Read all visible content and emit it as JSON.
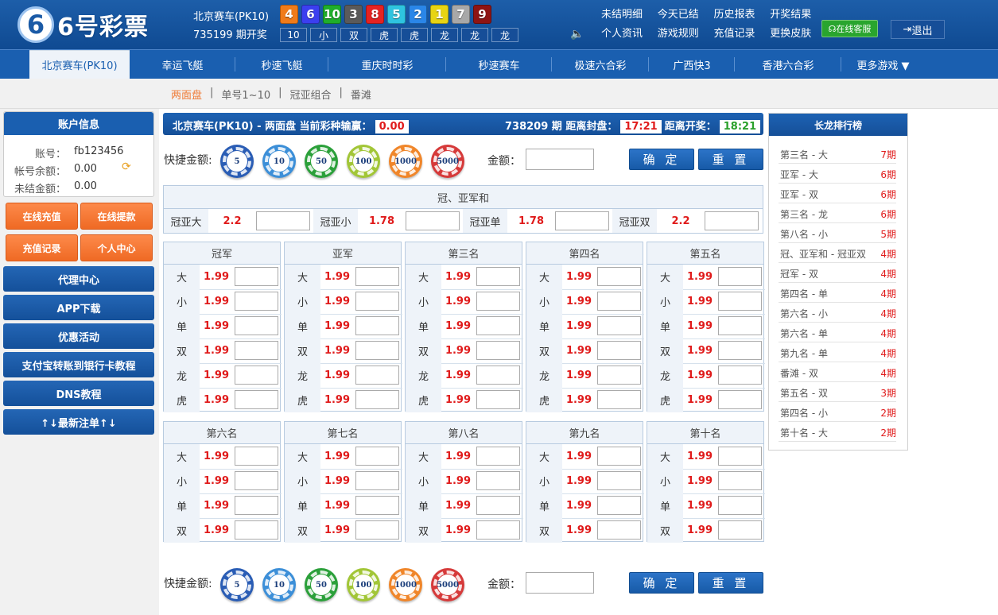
{
  "brand": {
    "logo_mark": "6",
    "logo_text": "6号彩票"
  },
  "header": {
    "lottery_name": "北京赛车(PK10)",
    "last_issue": "735199 期开奖",
    "balls": [
      {
        "num": "4",
        "color": "#f07b1a"
      },
      {
        "num": "6",
        "color": "#3b3ff0"
      },
      {
        "num": "10",
        "color": "#1fae2b"
      },
      {
        "num": "3",
        "color": "#5a5a5a"
      },
      {
        "num": "8",
        "color": "#e52222"
      },
      {
        "num": "5",
        "color": "#2ec4e0"
      },
      {
        "num": "2",
        "color": "#2a86e8"
      },
      {
        "num": "1",
        "color": "#e8d413"
      },
      {
        "num": "7",
        "color": "#a8a8a8"
      },
      {
        "num": "9",
        "color": "#8e1414"
      }
    ],
    "sums": [
      "10",
      "小",
      "双",
      "虎",
      "虎",
      "龙",
      "龙",
      "龙"
    ],
    "links": [
      "未结明细",
      "今天已结",
      "历史报表",
      "开奖结果",
      "个人资讯",
      "游戏规则",
      "充值记录",
      "更换皮肤"
    ],
    "kefu": "在线客服",
    "logout": "退出"
  },
  "nav": {
    "items": [
      "北京赛车(PK10)",
      "幸运飞艇",
      "秒速飞艇",
      "重庆时时彩",
      "秒速赛车",
      "极速六合彩",
      "广西快3",
      "香港六合彩",
      "更多游戏 ▼"
    ]
  },
  "subnav": {
    "items": [
      "两面盘",
      "|",
      "单号1~10",
      "|",
      "冠亚组合",
      "|",
      "番滩"
    ]
  },
  "account": {
    "title": "账户信息",
    "rows": [
      {
        "k": "账号：",
        "v": "fb123456"
      },
      {
        "k": "帐号余额：",
        "v": "0.00"
      },
      {
        "k": "未结金额：",
        "v": "0.00"
      }
    ],
    "buttons": [
      "在线充值",
      "在线提款",
      "充值记录",
      "个人中心"
    ],
    "menu": [
      "代理中心",
      "APP下载",
      "优惠活动",
      "支付宝转账到银行卡教程",
      "DNS教程",
      "↑↓最新注单↑↓"
    ]
  },
  "main": {
    "title": "北京赛车(PK10)  -  两面盘    当前彩种输赢：",
    "winloss": "0.00",
    "issue_text": "738209 期  距离封盘：",
    "close_time": "17:21",
    "open_label": "距离开奖：",
    "open_time": "18:21",
    "quick_label": "快捷金额:",
    "chips": [
      "5",
      "10",
      "50",
      "100",
      "1000",
      "5000"
    ],
    "amount_label": "金额：",
    "confirm": "确 定",
    "reset": "重 置",
    "gyh_title": "冠、亚军和",
    "gyh": [
      {
        "label": "冠亚大",
        "odds": "2.2"
      },
      {
        "label": "冠亚小",
        "odds": "1.78"
      },
      {
        "label": "冠亚单",
        "odds": "1.78"
      },
      {
        "label": "冠亚双",
        "odds": "2.2"
      }
    ],
    "top_groups": [
      "冠军",
      "亚军",
      "第三名",
      "第四名",
      "第五名"
    ],
    "top_rows": [
      "大",
      "小",
      "单",
      "双",
      "龙",
      "虎"
    ],
    "bottom_groups": [
      "第六名",
      "第七名",
      "第八名",
      "第九名",
      "第十名"
    ],
    "bottom_rows": [
      "大",
      "小",
      "单",
      "双"
    ],
    "odds": "1.99"
  },
  "ranking": {
    "title": "长龙排行榜",
    "items": [
      {
        "name": "第三名 - 大",
        "count": "7期"
      },
      {
        "name": "亚军 - 大",
        "count": "6期"
      },
      {
        "name": "亚军 - 双",
        "count": "6期"
      },
      {
        "name": "第三名 - 龙",
        "count": "6期"
      },
      {
        "name": "第八名 - 小",
        "count": "5期"
      },
      {
        "name": "冠、亚军和 - 冠亚双",
        "count": "4期"
      },
      {
        "name": "冠军 - 双",
        "count": "4期"
      },
      {
        "name": "第四名 - 单",
        "count": "4期"
      },
      {
        "name": "第六名 - 小",
        "count": "4期"
      },
      {
        "name": "第六名 - 单",
        "count": "4期"
      },
      {
        "name": "第九名 - 单",
        "count": "4期"
      },
      {
        "name": "番滩 - 双",
        "count": "4期"
      },
      {
        "name": "第五名 - 双",
        "count": "3期"
      },
      {
        "name": "第四名 - 小",
        "count": "2期"
      },
      {
        "name": "第十名 - 大",
        "count": "2期"
      }
    ]
  }
}
